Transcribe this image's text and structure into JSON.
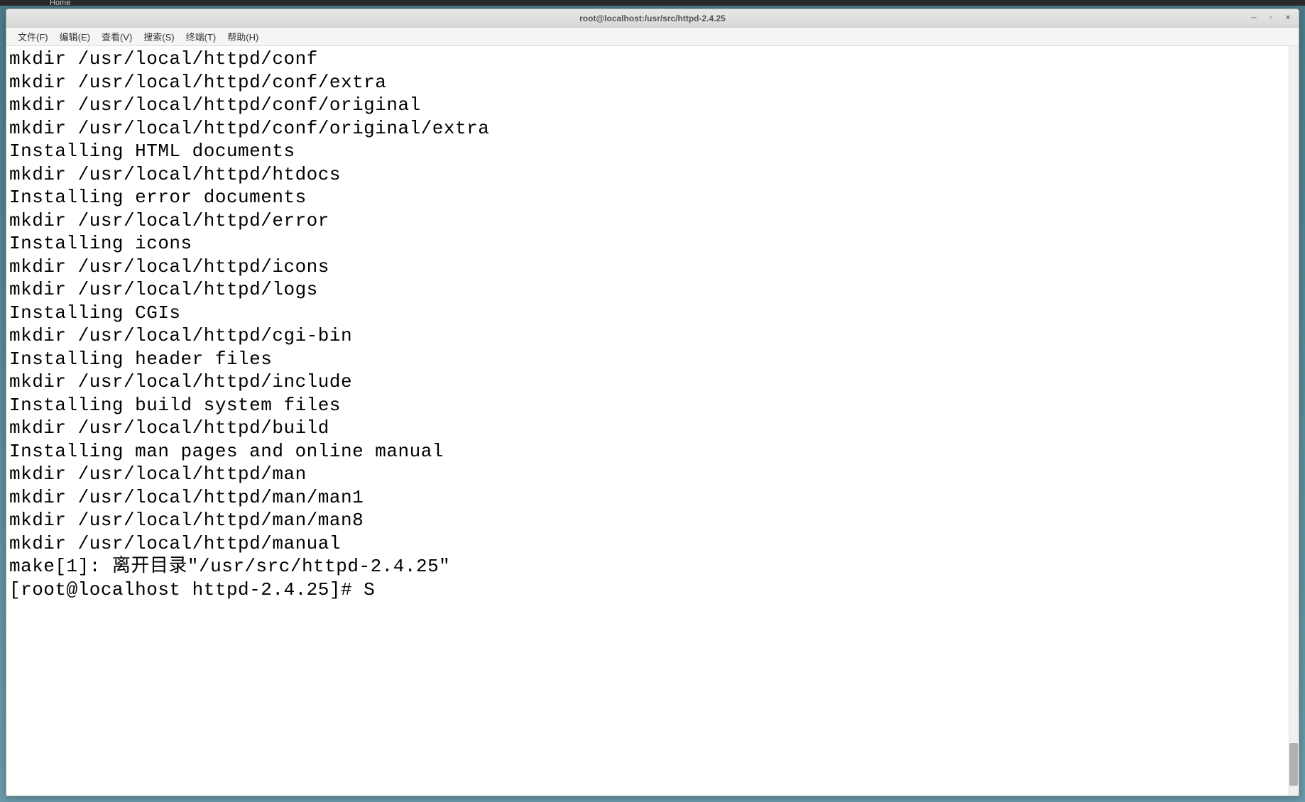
{
  "taskbar": {
    "home_label": "Home"
  },
  "window": {
    "title": "root@localhost:/usr/src/httpd-2.4.25"
  },
  "menubar": {
    "items": [
      "文件(F)",
      "编辑(E)",
      "查看(V)",
      "搜索(S)",
      "终端(T)",
      "帮助(H)"
    ]
  },
  "terminal": {
    "lines": [
      "mkdir /usr/local/httpd/conf",
      "mkdir /usr/local/httpd/conf/extra",
      "mkdir /usr/local/httpd/conf/original",
      "mkdir /usr/local/httpd/conf/original/extra",
      "Installing HTML documents",
      "mkdir /usr/local/httpd/htdocs",
      "Installing error documents",
      "mkdir /usr/local/httpd/error",
      "Installing icons",
      "mkdir /usr/local/httpd/icons",
      "mkdir /usr/local/httpd/logs",
      "Installing CGIs",
      "mkdir /usr/local/httpd/cgi-bin",
      "Installing header files",
      "mkdir /usr/local/httpd/include",
      "Installing build system files",
      "mkdir /usr/local/httpd/build",
      "Installing man pages and online manual",
      "mkdir /usr/local/httpd/man",
      "mkdir /usr/local/httpd/man/man1",
      "mkdir /usr/local/httpd/man/man8",
      "mkdir /usr/local/httpd/manual",
      "make[1]: 离开目录\"/usr/src/httpd-2.4.25\"",
      "[root@localhost httpd-2.4.25]# S"
    ]
  }
}
